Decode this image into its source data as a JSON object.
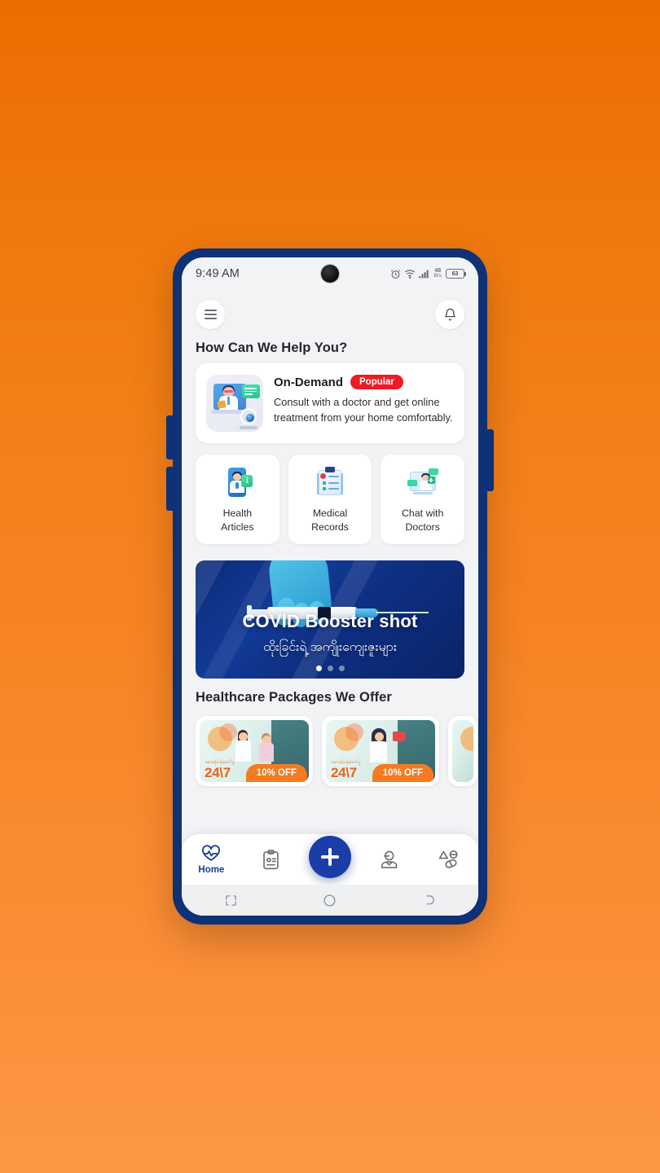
{
  "status_bar": {
    "time": "9:49 AM",
    "alarm_icon": "alarm-clock-icon",
    "wifi_icon": "wifi-icon",
    "signal_icon": "cellular-signal-icon",
    "net_speed_value": "48",
    "net_speed_unit": "B/s",
    "battery_level": "63",
    "battery_icon": "battery-icon"
  },
  "top_bar": {
    "menu_icon": "hamburger-menu-icon",
    "notification_icon": "bell-icon"
  },
  "sections": {
    "help_title": "How Can We Help You?",
    "packages_title": "Healthcare Packages We Offer"
  },
  "ondemand": {
    "title": "On-Demand",
    "badge": "Popular",
    "badge_color": "#ED1C24",
    "description": "Consult with a doctor and get online treatment from your home comfortably.",
    "illustration": "telemedicine-doctor-monitor-illustration"
  },
  "services": [
    {
      "label": "Health\nArticles",
      "line1": "Health",
      "line2": "Articles",
      "icon": "health-articles-icon"
    },
    {
      "label": "Medical\nRecords",
      "line1": "Medical",
      "line2": "Records",
      "icon": "medical-records-clipboard-icon"
    },
    {
      "label": "Chat with\nDoctors",
      "line1": "Chat with",
      "line2": "Doctors",
      "icon": "chat-with-doctors-icon"
    }
  ],
  "banner": {
    "title": "COVID Booster shot",
    "subtitle": "ထိုးခြင်းရဲ့ အကျိုးကျေးဇူးများ",
    "image": "gloved-hand-holding-syringe-photo",
    "dots_total": 3,
    "dot_active_index": 0,
    "background_color": "#0B2B78"
  },
  "packages": [
    {
      "burmese": "ဆေးခန်းဝန်ဆောင်မှု",
      "headline": "24\\7",
      "discount": "10% OFF",
      "image": "doctor-and-patient-illustration"
    },
    {
      "burmese": "ဆေးခန်းဝန်ဆောင်မှု",
      "headline": "24\\7",
      "discount": "10% OFF",
      "image": "female-doctor-illustration"
    }
  ],
  "bottom_nav": {
    "items": [
      {
        "label": "Home",
        "icon": "heart-pulse-icon",
        "active": true
      },
      {
        "label": "",
        "icon": "clipboard-records-icon",
        "active": false
      },
      {
        "label": "",
        "icon": "doctor-profile-icon",
        "active": false
      },
      {
        "label": "",
        "icon": "pills-medication-icon",
        "active": false
      }
    ],
    "fab_icon": "plus-icon",
    "fab_color": "#1B3DA8",
    "active_color": "#163F94"
  },
  "android_nav": {
    "recents_icon": "recents-icon",
    "home_icon": "home-circle-icon",
    "back_icon": "back-icon"
  },
  "device": {
    "frame_color": "#0E3275",
    "background_gradient_start": "#ED6C00",
    "background_gradient_end": "#FD9744"
  }
}
